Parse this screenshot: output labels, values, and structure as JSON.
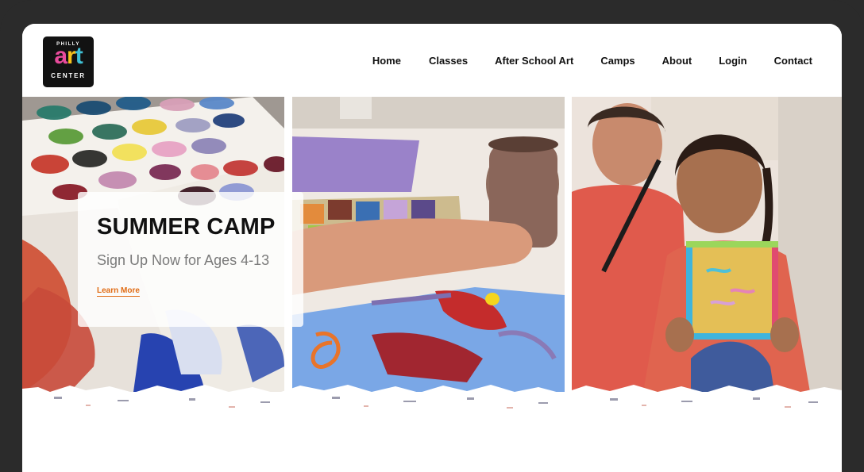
{
  "brand": {
    "logo_top": "PHILLY",
    "logo_a": "a",
    "logo_r": "r",
    "logo_t": "t",
    "logo_bottom": "CENTER",
    "colors": {
      "pink": "#e84b9c",
      "yellow": "#f5c21b",
      "teal": "#3fc1d6",
      "background": "#121212"
    }
  },
  "nav": {
    "items": [
      {
        "label": "Home"
      },
      {
        "label": "Classes"
      },
      {
        "label": "After School Art"
      },
      {
        "label": "Camps"
      },
      {
        "label": "About"
      },
      {
        "label": "Login"
      },
      {
        "label": "Contact"
      }
    ]
  },
  "hero": {
    "title": "SUMMER CAMP",
    "subtitle": "Sign Up Now for Ages 4-13",
    "cta_label": "Learn More",
    "accent_color": "#e06b14",
    "images": [
      {
        "icon": "paint-swatches-photo"
      },
      {
        "icon": "child-painting-photo"
      },
      {
        "icon": "child-with-craft-photo"
      }
    ]
  }
}
